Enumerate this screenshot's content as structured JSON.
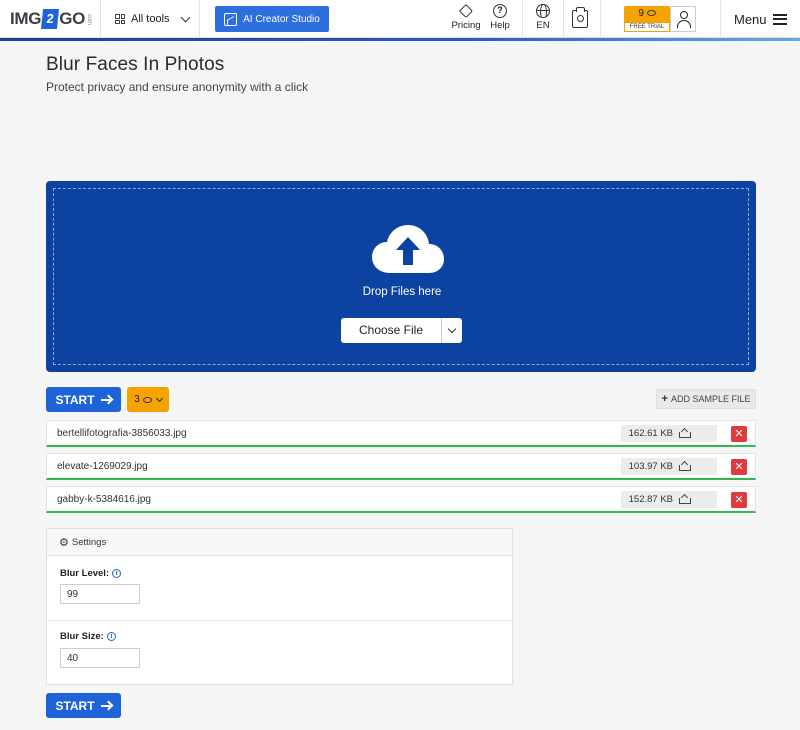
{
  "header": {
    "logo": {
      "left": "IMG",
      "mid": "2",
      "right": "GO",
      "suffix": ".com"
    },
    "all_tools": "All tools",
    "ai_studio": "AI Creator Studio",
    "pricing": "Pricing",
    "help": "Help",
    "language": "EN",
    "credits": "9",
    "free_trial": "FREE TRIAL",
    "menu": "Menu"
  },
  "page": {
    "title": "Blur Faces In Photos",
    "subtitle": "Protect privacy and ensure anonymity with a click"
  },
  "dropzone": {
    "drop_text": "Drop Files here",
    "choose_file": "Choose File"
  },
  "actions": {
    "start": "START",
    "coin_count": "3",
    "add_sample": "ADD SAMPLE FILE"
  },
  "files": [
    {
      "name": "bertellifotografia-3856033.jpg",
      "size": "162.61 KB"
    },
    {
      "name": "elevate-1269029.jpg",
      "size": "103.97 KB"
    },
    {
      "name": "gabby-k-5384616.jpg",
      "size": "152.87 KB"
    }
  ],
  "settings": {
    "title": "Settings",
    "blur_level": {
      "label": "Blur Level:",
      "value": "99"
    },
    "blur_size": {
      "label": "Blur Size:",
      "value": "40"
    }
  },
  "colors": {
    "primary": "#1f63d8",
    "dropzone": "#0d43a0",
    "accent_orange": "#f5a300",
    "success": "#2eb84f",
    "danger": "#e0393e"
  }
}
